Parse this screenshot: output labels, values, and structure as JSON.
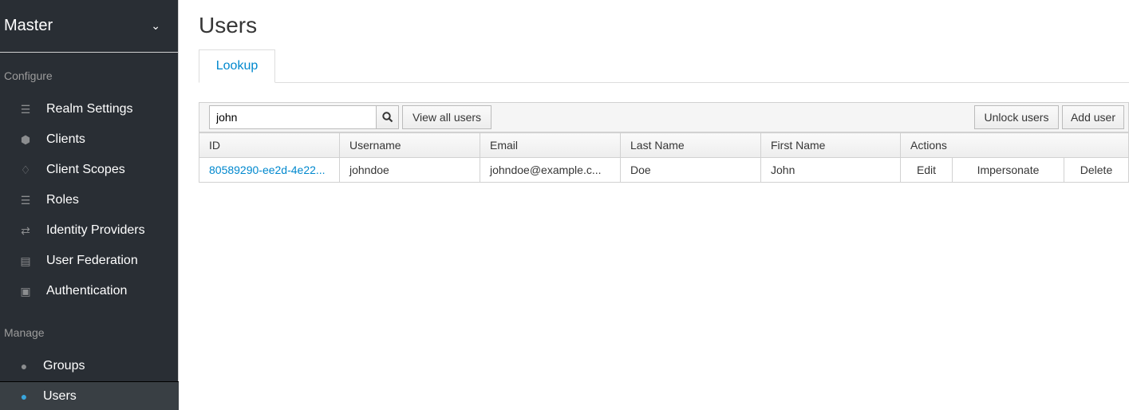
{
  "sidebar": {
    "realm": "Master",
    "configure_label": "Configure",
    "manage_label": "Manage",
    "configure_items": [
      {
        "label": "Realm Settings",
        "icon": "sliders-icon"
      },
      {
        "label": "Clients",
        "icon": "cube-icon"
      },
      {
        "label": "Client Scopes",
        "icon": "cubes-icon"
      },
      {
        "label": "Roles",
        "icon": "server-icon"
      },
      {
        "label": "Identity Providers",
        "icon": "exchange-icon"
      },
      {
        "label": "User Federation",
        "icon": "database-icon"
      },
      {
        "label": "Authentication",
        "icon": "lock-icon"
      }
    ],
    "manage_items": [
      {
        "label": "Groups",
        "icon": "users-icon"
      },
      {
        "label": "Users",
        "icon": "user-icon",
        "active": true
      }
    ]
  },
  "page": {
    "title": "Users",
    "tab": "Lookup"
  },
  "toolbar": {
    "search_value": "john",
    "view_all": "View all users",
    "unlock": "Unlock users",
    "add": "Add user"
  },
  "table": {
    "headers": [
      "ID",
      "Username",
      "Email",
      "Last Name",
      "First Name",
      "Actions"
    ],
    "rows": [
      {
        "id": "80589290-ee2d-4e22...",
        "username": "johndoe",
        "email": "johndoe@example.c...",
        "last_name": "Doe",
        "first_name": "John",
        "actions": [
          "Edit",
          "Impersonate",
          "Delete"
        ]
      }
    ]
  },
  "colors": {
    "sidebar_bg": "#292e34",
    "link": "#0088ce",
    "active_icon": "#39a5dc"
  }
}
